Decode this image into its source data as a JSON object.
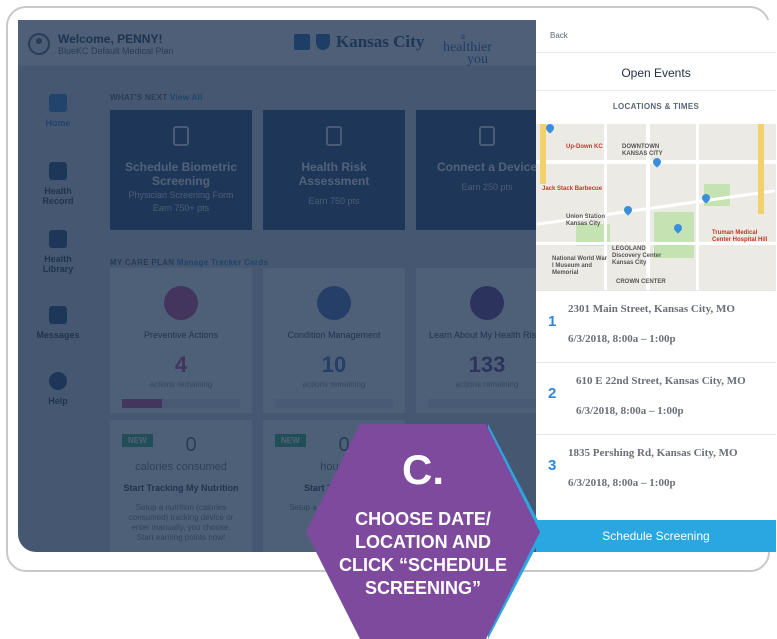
{
  "header": {
    "welcome": "Welcome, PENNY!",
    "plan": "BlueKC Default Medical Plan",
    "brand_city": "Kansas City",
    "healthier_a": "a",
    "healthier_b": "healthier",
    "healthier_c": "you"
  },
  "nav": {
    "items": [
      {
        "label": "Home",
        "icon": "home-icon"
      },
      {
        "label": "Health Record",
        "icon": "clipboard-icon"
      },
      {
        "label": "Health Library",
        "icon": "book-icon"
      },
      {
        "label": "Messages",
        "icon": "inbox-icon"
      },
      {
        "label": "Help",
        "icon": "info-icon"
      }
    ]
  },
  "whats_next": {
    "heading": "WHAT'S NEXT",
    "view_all": "View All",
    "cards": [
      {
        "title": "Schedule Biometric Screening",
        "sub1": "Physician Screening Form",
        "sub2": "Earn 750+ pts",
        "icon": "fingerprint-icon"
      },
      {
        "title": "Health Risk Assessment",
        "sub1": "Earn 750 pts",
        "sub2": "",
        "icon": "checklist-icon"
      },
      {
        "title": "Connect a Device",
        "sub1": "Earn 250 pts",
        "sub2": "",
        "icon": "watch-icon"
      }
    ]
  },
  "care_plan": {
    "heading": "MY CARE PLAN",
    "manage": "Manage Tracker Cards",
    "cards": [
      {
        "title": "Preventive Actions",
        "value": "4",
        "remaining": "actions remaining",
        "color": "#c2368a",
        "progress": 0.33
      },
      {
        "title": "Condition Management",
        "value": "10",
        "remaining": "actions remaining",
        "color": "#3b63b8",
        "progress": 0
      },
      {
        "title": "Learn About My Health Risks",
        "value": "133",
        "remaining": "actions remaining",
        "color": "#5b2f86",
        "progress": 0
      }
    ]
  },
  "trackers": [
    {
      "badge": "NEW",
      "value": "0",
      "label": "calories consumed",
      "title": "Start Tracking My Nutrition",
      "desc": "Setup a nutrition (calories consumed) tracking device or enter manually, you choose. Start earning points now!"
    },
    {
      "badge": "NEW",
      "value": "0",
      "label": "hours",
      "title": "Start Tracking",
      "desc": "Setup a ... or en... choo..."
    }
  ],
  "panel": {
    "back": "Back",
    "title": "Open Events",
    "locations_heading": "LOCATIONS & TIMES",
    "map_labels": {
      "downtown": "DOWNTOWN KANSAS CITY",
      "crown": "CROWN CENTER",
      "union": "Union Station Kansas City",
      "truman": "Truman Medical Center Hospital Hill",
      "memorial": "National World War I Museum and Memorial",
      "legoland": "LEGOLAND Discovery Center Kansas City",
      "jackstack": "Jack Stack Barbecue",
      "uplift": "Up-Down KC"
    },
    "locations": [
      {
        "num": "1",
        "address": "2301 Main Street, Kansas City, MO",
        "datetime": "6/3/2018, 8:00a – 1:00p"
      },
      {
        "num": "2",
        "address": "610 E 22nd Street, Kansas City, MO",
        "datetime": "6/3/2018, 8:00a – 1:00p"
      },
      {
        "num": "3",
        "address": "1835 Pershing Rd, Kansas City, MO",
        "datetime": "6/3/2018, 8:00a – 1:00p"
      }
    ],
    "schedule_button": "Schedule Screening"
  },
  "callout": {
    "letter": "C.",
    "lines": [
      "CHOOSE DATE/",
      "LOCATION AND",
      "CLICK “SCHEDULE",
      "SCREENING”"
    ],
    "fill": "#7d4a9e",
    "edge": "#2aa7e0"
  }
}
